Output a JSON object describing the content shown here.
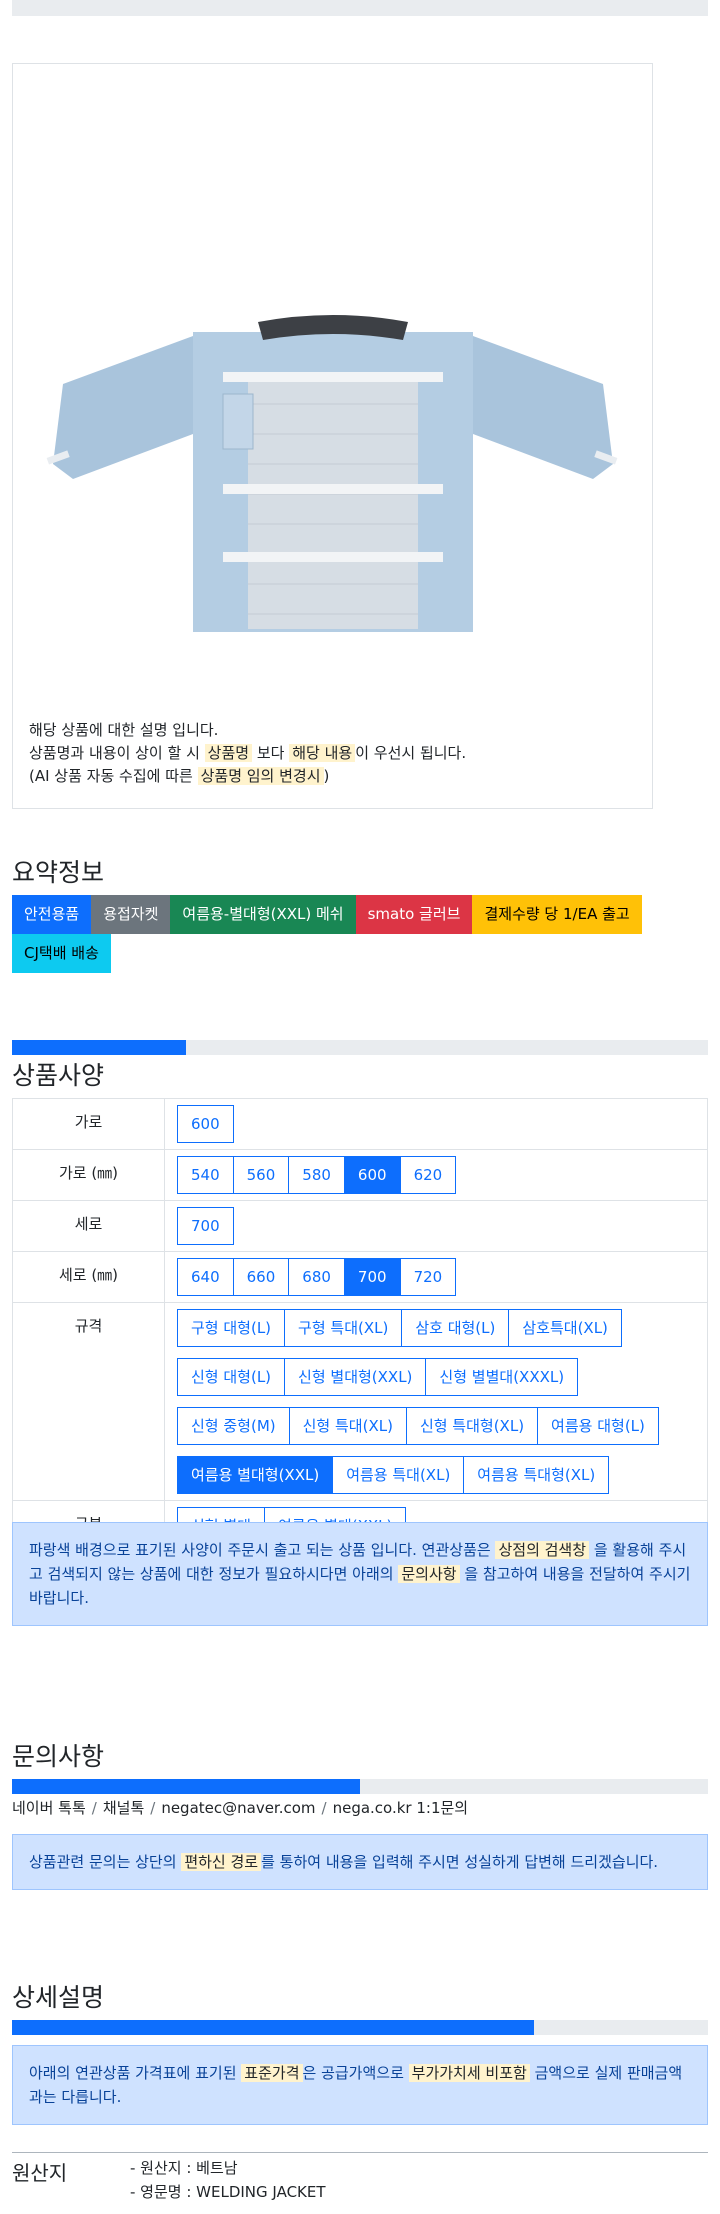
{
  "image_description": {
    "line1": "해당 상품에 대한 설명 입니다.",
    "line2_a": "상품명과 내용이 상이 할 시",
    "line2_hl1": "상품명",
    "line2_b": "보다",
    "line2_hl2": "해당 내용",
    "line2_c": "이 우선시 됩니다.",
    "line3_a": "(AI 상품 자동 수집에 따른",
    "line3_hl": "상품명 임의 변경시",
    "line3_b": ")"
  },
  "summary": {
    "title": "요약정보",
    "badges": [
      {
        "label": "안전용품",
        "color": "#0d6efd",
        "text_color": "#ffffff"
      },
      {
        "label": "용접자켓",
        "color": "#6c757d",
        "text_color": "#ffffff"
      },
      {
        "label": "여름용-별대형(XXL) 메쉬",
        "color": "#198754",
        "text_color": "#ffffff"
      },
      {
        "label": "smato 글러브",
        "color": "#dc3545",
        "text_color": "#ffffff"
      },
      {
        "label": "결제수량 당 1/EA 출고",
        "color": "#ffc107",
        "text_color": "#000000"
      },
      {
        "label": "CJ택배 배송",
        "color": "#0dcaf0",
        "text_color": "#000000"
      }
    ]
  },
  "spec": {
    "title": "상품사양",
    "progress": 0.25,
    "rows": [
      {
        "label": "가로",
        "options": [
          [
            {
              "t": "600",
              "sel": false
            }
          ]
        ]
      },
      {
        "label": "가로 (㎜)",
        "options": [
          [
            {
              "t": "540",
              "sel": false
            },
            {
              "t": "560",
              "sel": false
            },
            {
              "t": "580",
              "sel": false
            },
            {
              "t": "600",
              "sel": true
            },
            {
              "t": "620",
              "sel": false
            }
          ]
        ]
      },
      {
        "label": "세로",
        "options": [
          [
            {
              "t": "700",
              "sel": false
            }
          ]
        ]
      },
      {
        "label": "세로 (㎜)",
        "options": [
          [
            {
              "t": "640",
              "sel": false
            },
            {
              "t": "660",
              "sel": false
            },
            {
              "t": "680",
              "sel": false
            },
            {
              "t": "700",
              "sel": true
            },
            {
              "t": "720",
              "sel": false
            }
          ]
        ]
      },
      {
        "label": "규격",
        "options": [
          [
            {
              "t": "구형 대형(L)",
              "sel": false
            },
            {
              "t": "구형 특대(XL)",
              "sel": false
            },
            {
              "t": "삼호 대형(L)",
              "sel": false
            },
            {
              "t": "삼호특대(XL)",
              "sel": false
            }
          ],
          [
            {
              "t": "신형 대형(L)",
              "sel": false
            },
            {
              "t": "신형 별대형(XXL)",
              "sel": false
            },
            {
              "t": "신형 별별대(XXXL)",
              "sel": false
            }
          ],
          [
            {
              "t": "신형 중형(M)",
              "sel": false
            },
            {
              "t": "신형 특대(XL)",
              "sel": false
            },
            {
              "t": "신형 특대형(XL)",
              "sel": false
            },
            {
              "t": "여름용 대형(L)",
              "sel": false
            }
          ],
          [
            {
              "t": "여름용 별대형(XXL)",
              "sel": true
            },
            {
              "t": "여름용 특대(XL)",
              "sel": false
            },
            {
              "t": "여름용 특대형(XL)",
              "sel": false
            }
          ]
        ]
      },
      {
        "label": "구분",
        "options": [
          [
            {
              "t": "신형 별대",
              "sel": false
            },
            {
              "t": "여름용 별대(XXL)",
              "sel": false
            }
          ]
        ]
      }
    ],
    "note_a": "파랑색 배경으로 표기된 사양이 주문시 출고 되는 상품 입니다. 연관상품은",
    "note_hl1": "상점의 검색창",
    "note_b": "을 활용해 주시고 검색되지 않는 상품에 대한 정보가 필요하시다면 아래의",
    "note_hl2": "문의사항",
    "note_c": "을 참고하여 내용을 전달하여 주시기 바랍니다."
  },
  "inquiry": {
    "title": "문의사항",
    "progress": 0.5,
    "contacts": [
      "네이버 톡톡",
      "채널톡",
      "negatec@naver.com",
      "nega.co.kr 1:1문의"
    ],
    "separator": "/",
    "note_a": "상품관련 문의는 상단의",
    "note_hl": "편하신 경로",
    "note_b": "를 통하여 내용을 입력해 주시면 성실하게 답변해 드리겠습니다."
  },
  "detail": {
    "title": "상세설명",
    "progress": 0.75,
    "note_a": "아래의 연관상품 가격표에 표기된",
    "note_hl1": "표준가격",
    "note_b": "은 공급가액으로",
    "note_hl2": "부가가치세 비포함",
    "note_c": "금액으로 실제 판매금액과는 다릅니다."
  },
  "origin": {
    "label": "원산지",
    "lines": [
      "- 원산지 : 베트남",
      "- 영문명 : WELDING JACKET"
    ]
  }
}
